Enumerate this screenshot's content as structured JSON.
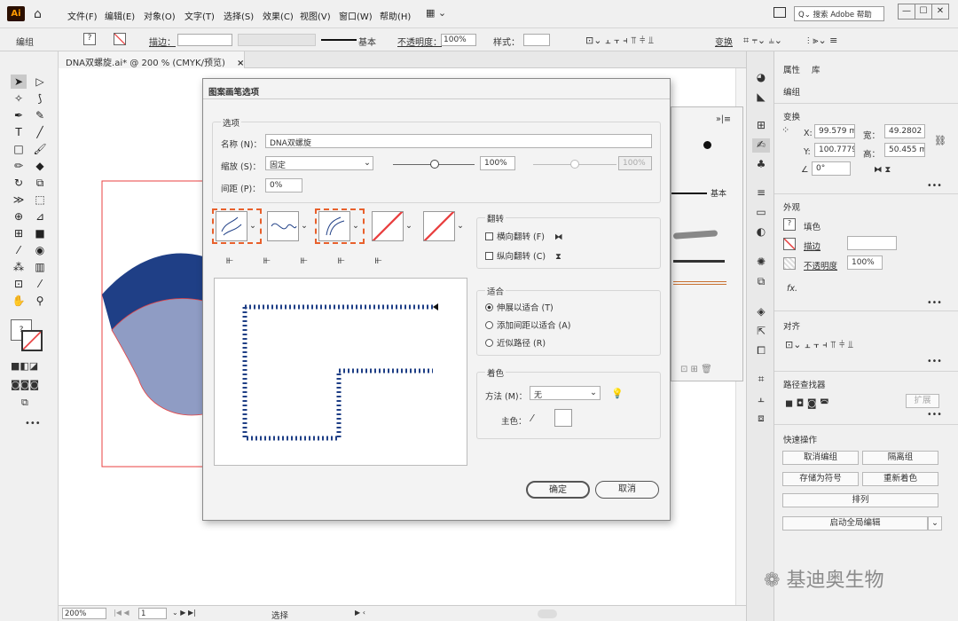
{
  "menubar": {
    "logo": "Ai",
    "items": [
      "文件(F)",
      "编辑(E)",
      "对象(O)",
      "文字(T)",
      "选择(S)",
      "效果(C)",
      "视图(V)",
      "窗口(W)",
      "帮助(H)"
    ],
    "search_placeholder": "搜索 Adobe 帮助",
    "win_controls": [
      "—",
      "☐",
      "✕"
    ]
  },
  "control_bar": {
    "group_label": "编组",
    "stroke_label": "描边：",
    "stroke_style": "基本",
    "opacity_label": "不透明度：",
    "opacity_value": "100%",
    "style_label": "样式：",
    "transform_label": "变换"
  },
  "document": {
    "tab_title": "DNA双螺旋.ai* @ 200 % (CMYK/预览)",
    "tab_close": "×",
    "zoom": "200%",
    "page": "1",
    "status_tool": "选择"
  },
  "dialog": {
    "title": "图案画笔选项",
    "options_header": "选项",
    "name_label": "名称 (N)：",
    "name_value": "DNA双螺旋",
    "scale_label": "缩放 (S)：",
    "scale_mode": "固定",
    "scale_value1": "100%",
    "scale_value2": "100%",
    "spacing_label": "间距 (P)：",
    "spacing_value": "0%",
    "flip_header": "翻转",
    "flip_h": "横向翻转 (F)",
    "flip_v": "纵向翻转 (C)",
    "fit_header": "适合",
    "fit_options": [
      "伸展以适合 (T)",
      "添加间距以适合 (A)",
      "近似路径 (R)"
    ],
    "fit_selected": 0,
    "color_header": "着色",
    "method_label": "方法 (M)：",
    "method_value": "无",
    "key_color_label": "主色：",
    "ok": "确定",
    "cancel": "取消"
  },
  "behind_panel": {
    "header": "»|≡",
    "basic_label": "基本"
  },
  "properties": {
    "tabs": [
      "属性",
      "库"
    ],
    "group": "编组",
    "transform_header": "变换",
    "x_label": "X:",
    "x_value": "99.579 m",
    "y_label": "Y:",
    "y_value": "100.7779",
    "w_label": "宽：",
    "w_value": "49.2802",
    "h_label": "高：",
    "h_value": "50.455 m",
    "angle_value": "0°",
    "appearance_header": "外观",
    "fill_label": "填色",
    "stroke_label": "描边",
    "opacity_label": "不透明度",
    "opacity_value": "100%",
    "fx_label": "fx.",
    "align_header": "对齐",
    "pathfinder_header": "路径查找器",
    "expand_label": "扩展",
    "quick_actions_header": "快速操作",
    "btn_ungroup": "取消编组",
    "btn_isolate": "隔离组",
    "btn_save_symbol": "存储为符号",
    "btn_recolor": "重新着色",
    "btn_arrange": "排列",
    "btn_global_edit": "启动全局编辑",
    "more": "•••"
  },
  "watermark": "基迪奥生物",
  "colors": {
    "accent_orange": "#e8602c",
    "ribbon_dark": "#1f3f86",
    "ribbon_light": "#8f9cc4",
    "selection_red": "#e84040"
  }
}
